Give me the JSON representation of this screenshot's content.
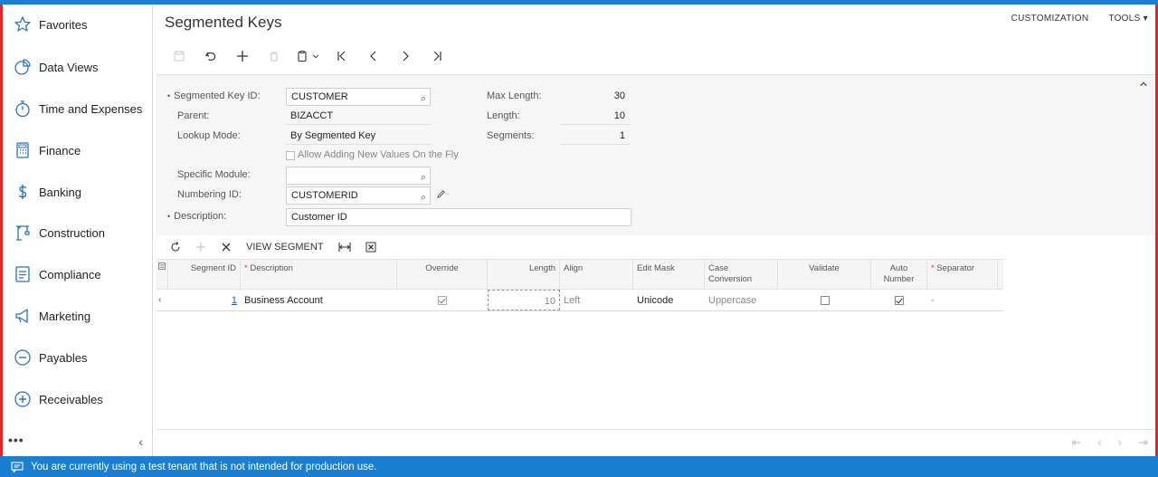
{
  "sidebar": {
    "items": [
      {
        "label": "Favorites",
        "icon": "star-icon"
      },
      {
        "label": "Data Views",
        "icon": "pie-chart-icon"
      },
      {
        "label": "Time and Expenses",
        "icon": "stopwatch-icon"
      },
      {
        "label": "Finance",
        "icon": "calculator-icon"
      },
      {
        "label": "Banking",
        "icon": "dollar-icon"
      },
      {
        "label": "Construction",
        "icon": "crane-icon"
      },
      {
        "label": "Compliance",
        "icon": "checklist-icon"
      },
      {
        "label": "Marketing",
        "icon": "megaphone-icon"
      },
      {
        "label": "Payables",
        "icon": "minus-circle-icon"
      },
      {
        "label": "Receivables",
        "icon": "plus-circle-icon"
      }
    ],
    "more": "•••",
    "collapse": "‹"
  },
  "header": {
    "title": "Segmented Keys",
    "customization": "CUSTOMIZATION",
    "tools": "TOOLS ▾"
  },
  "form": {
    "segmented_key_id_label": "Segmented Key ID:",
    "segmented_key_id": "CUSTOMER",
    "parent_label": "Parent:",
    "parent": "BIZACCT",
    "lookup_mode_label": "Lookup Mode:",
    "lookup_mode": "By Segmented Key",
    "allow_adding_label": "Allow Adding New Values On the Fly",
    "specific_module_label": "Specific Module:",
    "specific_module": "",
    "numbering_id_label": "Numbering ID:",
    "numbering_id": "CUSTOMERID",
    "description_label": "Description:",
    "description": "Customer ID",
    "max_length_label": "Max Length:",
    "max_length": "30",
    "length_label": "Length:",
    "length": "10",
    "segments_label": "Segments:",
    "segments": "1"
  },
  "grid_toolbar": {
    "view_segment": "VIEW SEGMENT"
  },
  "grid": {
    "headers": {
      "segment_id": "Segment ID",
      "description": "Description",
      "override": "Override",
      "length": "Length",
      "align": "Align",
      "edit_mask": "Edit Mask",
      "case_conversion": "Case Conversion",
      "validate": "Validate",
      "auto_number": "Auto Number",
      "separator": "Separator"
    },
    "rows": [
      {
        "segment_id": "1",
        "description": "Business Account",
        "override": true,
        "length": "10",
        "align": "Left",
        "edit_mask": "Unicode",
        "case_conversion": "Uppercase",
        "validate": false,
        "auto_number": true,
        "separator": "-"
      }
    ]
  },
  "statusbar": {
    "message": "You are currently using a test tenant that is not intended for production use."
  },
  "colors": {
    "accent": "#1b7fd1",
    "frame": "#e32727"
  }
}
